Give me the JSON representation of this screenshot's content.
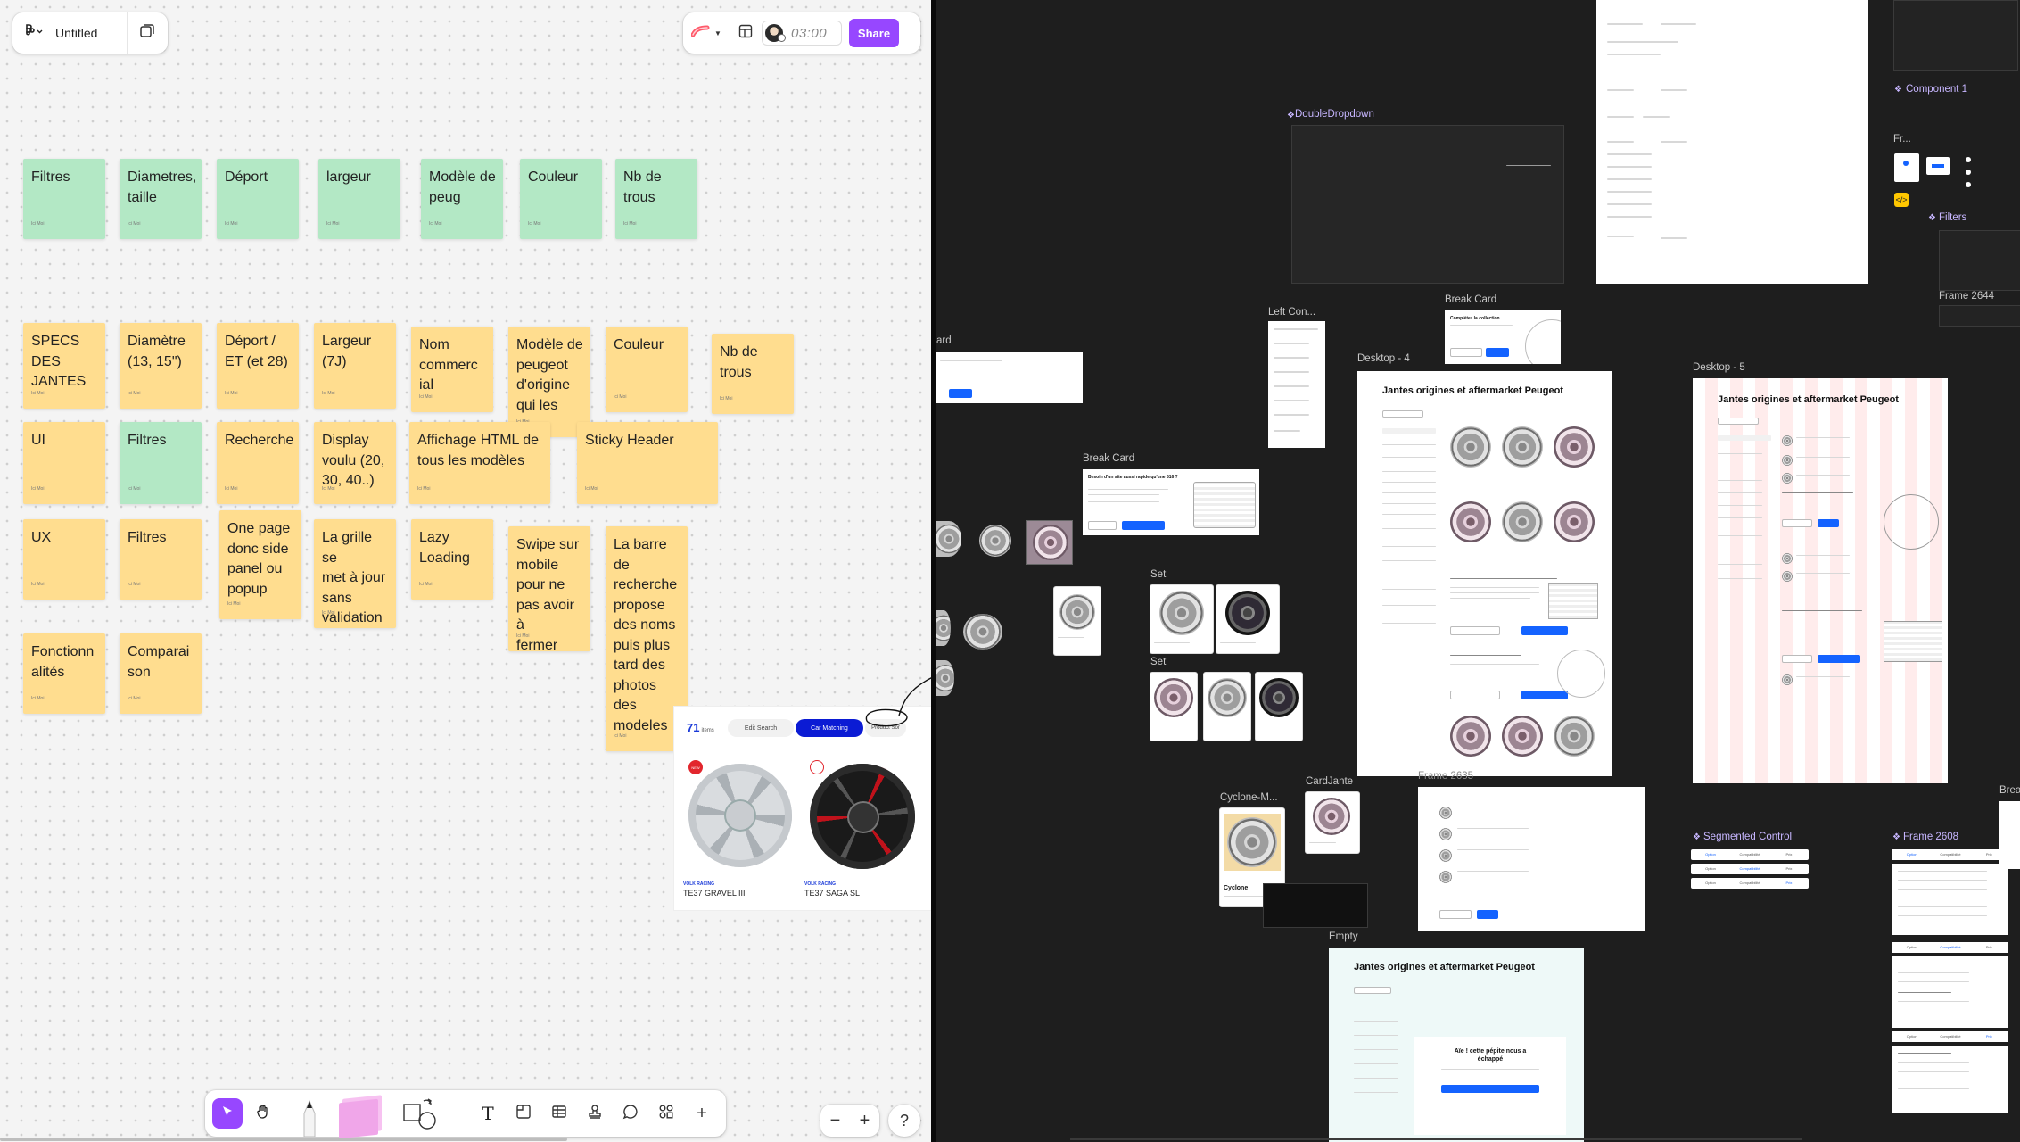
{
  "file": {
    "title": "Untitled"
  },
  "header": {
    "timer": "03:00",
    "share_label": "Share"
  },
  "stickies": [
    {
      "id": "s01",
      "text": "Filtres",
      "color": "green",
      "author": "Ici Moi"
    },
    {
      "id": "s02",
      "text": "Diametres,\ntaille",
      "color": "green",
      "author": "Ici Moi"
    },
    {
      "id": "s03",
      "text": "Déport",
      "color": "green",
      "author": "Ici Moi"
    },
    {
      "id": "s04",
      "text": "largeur",
      "color": "green",
      "author": "Ici Moi"
    },
    {
      "id": "s05",
      "text": "Modèle de\npeug",
      "color": "green",
      "author": "Ici Moi"
    },
    {
      "id": "s06",
      "text": "Couleur",
      "color": "green",
      "author": "Ici Moi"
    },
    {
      "id": "s07",
      "text": "Nb de\ntrous",
      "color": "green",
      "author": "Ici Moi"
    },
    {
      "id": "s08",
      "text": "SPECS\nDES\nJANTES",
      "color": "yellow",
      "author": "Ici Moi"
    },
    {
      "id": "s09",
      "text": "Diamètre\n(13, 15\")",
      "color": "yellow",
      "author": "Ici Moi"
    },
    {
      "id": "s10",
      "text": "Déport /\nET (et 28)",
      "color": "yellow",
      "author": "Ici Moi"
    },
    {
      "id": "s11",
      "text": "Largeur\n(7J)",
      "color": "yellow",
      "author": "Ici Moi"
    },
    {
      "id": "s12",
      "text": "Nom\ncommerc\nial",
      "color": "yellow",
      "author": "Ici Moi"
    },
    {
      "id": "s13",
      "text": "Modèle de\npeugeot\nd'origine\nqui les",
      "color": "yellow",
      "author": "Ici Moi"
    },
    {
      "id": "s14",
      "text": "Couleur",
      "color": "yellow",
      "author": "Ici Moi"
    },
    {
      "id": "s15",
      "text": "Nb de\ntrous",
      "color": "yellow",
      "author": "Ici Moi"
    },
    {
      "id": "s16",
      "text": "UI",
      "color": "yellow",
      "author": "Ici Moi"
    },
    {
      "id": "s17",
      "text": "Filtres",
      "color": "green",
      "author": "Ici Moi"
    },
    {
      "id": "s18",
      "text": "Recherche",
      "color": "yellow",
      "author": "Ici Moi"
    },
    {
      "id": "s19",
      "text": "Display\nvoulu (20,\n30, 40..)",
      "color": "yellow",
      "author": "Ici Moi"
    },
    {
      "id": "s20",
      "text": "Affichage HTML de\ntous les modèles",
      "color": "yellow",
      "author": "Ici Moi"
    },
    {
      "id": "s21",
      "text": "Sticky Header",
      "color": "yellow",
      "author": "Ici Moi"
    },
    {
      "id": "s22",
      "text": "UX",
      "color": "yellow",
      "author": "Ici Moi"
    },
    {
      "id": "s23",
      "text": "Filtres",
      "color": "yellow",
      "author": "Ici Moi"
    },
    {
      "id": "s24",
      "text": "One page\ndonc side\npanel ou\npopup",
      "color": "yellow",
      "author": "Ici Moi"
    },
    {
      "id": "s25",
      "text": "La grille se\nmet à jour\nsans\nvalidation",
      "color": "yellow",
      "author": "Ici Moi"
    },
    {
      "id": "s26",
      "text": "Lazy\nLoading",
      "color": "yellow",
      "author": "Ici Moi"
    },
    {
      "id": "s27",
      "text": "Swipe sur\nmobile\npour ne\npas avoir à\nfermer",
      "color": "yellow",
      "author": "Ici Moi"
    },
    {
      "id": "s28",
      "text": "La barre\nde\nrecherche\npropose\ndes noms\npuis plus\ntard des\nphotos\ndes\nmodeles",
      "color": "yellow",
      "author": "Ici Moi"
    },
    {
      "id": "s29",
      "text": "Fonctionn\nalités",
      "color": "yellow",
      "author": "Ici Moi"
    },
    {
      "id": "s30",
      "text": "Comparai\nson",
      "color": "yellow",
      "author": "Ici Moi"
    }
  ],
  "screenshot_embed": {
    "count": "71",
    "count_suffix": "items",
    "edit_search": "Edit Search",
    "car_matching": "Car Matching",
    "product_sort": "Product Sor",
    "products": [
      {
        "brand": "VOLK RACING",
        "name": "TE37 GRAVEL III",
        "badge": "NEW"
      },
      {
        "brand": "VOLK RACING",
        "name": "TE37 SAGA SL",
        "badge": ""
      }
    ]
  },
  "canvas_labels": {
    "double_dropdown": "DoubleDropdown",
    "component_1": "Component 1",
    "filters": "Filters",
    "frame_2644": "Frame 2644",
    "fr": "Fr...",
    "left_con": "Left Con...",
    "break_card_1": "Break Card",
    "break_card_2": "Break Card",
    "desktop_4": "Desktop - 4",
    "desktop_5": "Desktop - 5",
    "set_1": "Set",
    "set_2": "Set",
    "ard": "ard",
    "cyclone": "Cyclone-M...",
    "card_jante": "CardJante",
    "frame_partial": "Frame 2635",
    "empty": "Empty",
    "segmented_control": "Segmented Control",
    "frame_2608": "Frame 2608",
    "brea": "Brea"
  },
  "frames": {
    "desktop_4_title": "Jantes origines et aftermarket Peugeot",
    "desktop_5_title": "Jantes origines et aftermarket Peugeot",
    "empty_title": "Jantes origines et aftermarket Peugeot",
    "empty_message": "Aïe ! cette pépite nous a échappé",
    "break_card_text": "Complétez la collection.",
    "break_card_cta": "Besoin d'un site aussi rapide qu'une 516 ?",
    "cyclone_name": "Cyclone",
    "segmented_options": [
      "Option",
      "Compatibilité",
      "Prix"
    ]
  },
  "zoom": {
    "minus": "−",
    "plus": "+",
    "help": "?"
  },
  "colors": {
    "accent": "#9747ff",
    "share": "#9747ff",
    "blue": "#1463ff"
  }
}
